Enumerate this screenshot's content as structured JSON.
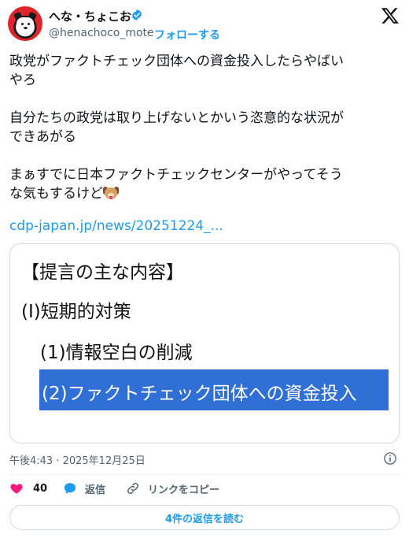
{
  "author": {
    "display_name": "へな・ちょこお",
    "handle": "@henachoco_mote",
    "separator": "·",
    "follow_label": "フォローする",
    "avatar_icon": "dog-avatar-icon",
    "verified_icon": "verified-badge-icon"
  },
  "tweet": {
    "lines": [
      "政党がファクトチェック団体への資金投入したらやばい",
      "やろ",
      "自分たちの政党は取り上げないとかいう恣意的な状況が",
      "できあがる",
      "まぁすでに日本ファクトチェックセンターがやってそう",
      "な気もするけど"
    ],
    "emoji": "dog-face-emoji",
    "link": "cdp-japan.jp/news/20251224_..."
  },
  "media": {
    "title": "【提言の主な内容】",
    "item1": "(Ⅰ)短期的対策",
    "item2": "(1)情報空白の削減",
    "item3": "(2)ファクトチェック団体への資金投入",
    "highlight_color": "#2f6fd6"
  },
  "meta": {
    "timestamp": "午後4:43 · 2025年12月25日"
  },
  "actions": {
    "like_count": "40",
    "reply_label": "返信",
    "copy_link_label": "リンクをコピー"
  },
  "footer": {
    "read_replies_label": "4件の返信を読む"
  },
  "colors": {
    "accent": "#1d9bf0",
    "like": "#f91880",
    "text": "#0f1419",
    "muted": "#536471"
  }
}
